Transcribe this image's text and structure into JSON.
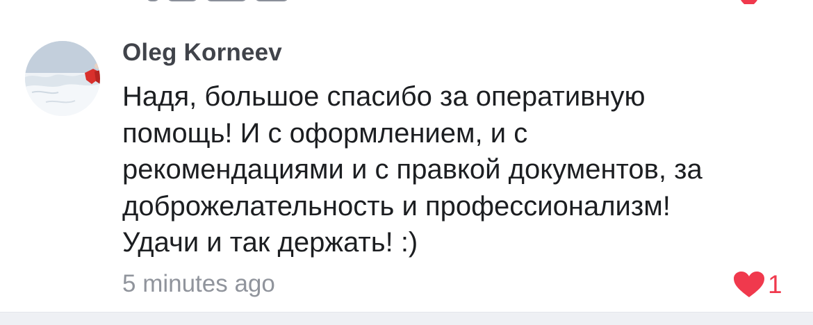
{
  "comment": {
    "author": "Oleg Korneev",
    "text_lines": [
      "Надя, большое спасибо за оперативную",
      "помощь! И с оформлением, и с",
      "рекомендациями и с правкой документов, за",
      "доброжелательность и профессионализм!",
      "Удачи и так держать! :)"
    ],
    "timestamp": "5 minutes ago",
    "reaction": {
      "icon": "heart-icon",
      "count": "1",
      "color": "#f0394d"
    }
  },
  "colors": {
    "author": "#40434a",
    "text": "#1c1e21",
    "meta": "#90949c",
    "footer": "#eef0f4"
  }
}
